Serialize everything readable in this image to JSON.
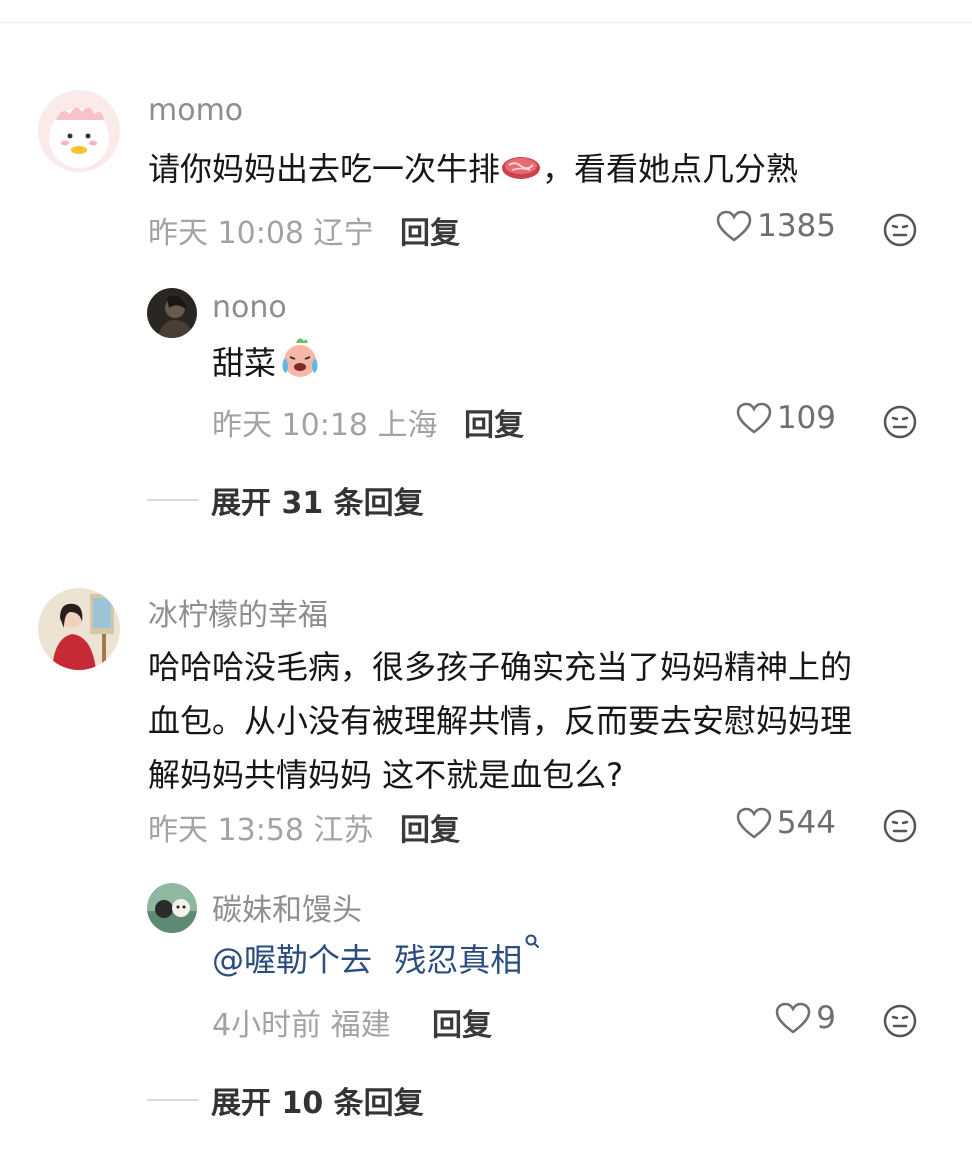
{
  "comments": [
    {
      "username": "momo",
      "text_before_emoji": "请你妈妈出去吃一次牛排",
      "emoji": "steak-emoji",
      "text_after_emoji": "，看看她点几分熟",
      "time": "昨天 10:08",
      "location": "辽宁",
      "reply_label": "回复",
      "likes": "1385",
      "replies": [
        {
          "username": "nono",
          "text": "甜菜",
          "emoji": "crying-radish-emoji",
          "time": "昨天 10:18",
          "location": "上海",
          "reply_label": "回复",
          "likes": "109"
        }
      ],
      "expand_label": "展开 31 条回复"
    },
    {
      "username": "冰柠檬的幸福",
      "text_lines": [
        "哈哈哈没毛病，很多孩子确实充当了妈妈精神上的",
        "血包。从小没有被理解共情，反而要去安慰妈妈理",
        "解妈妈共情妈妈 这不就是血包么?"
      ],
      "time": "昨天 13:58",
      "location": "江苏",
      "reply_label": "回复",
      "likes": "544",
      "replies": [
        {
          "username": "碳妹和馒头",
          "mention": "@喔勒个去",
          "link_text": "残忍真相",
          "link_icon": "search-icon",
          "time": "4小时前",
          "location": "福建",
          "reply_label": "回复",
          "likes": "9"
        }
      ],
      "expand_label": "展开 10 条回复"
    }
  ],
  "colors": {
    "username": "#8e8e8e",
    "meta": "#a3a3a3",
    "mention": "#2b4c7e"
  },
  "icons": {
    "like": "heart-outline-icon",
    "react": "neutral-face-icon"
  }
}
